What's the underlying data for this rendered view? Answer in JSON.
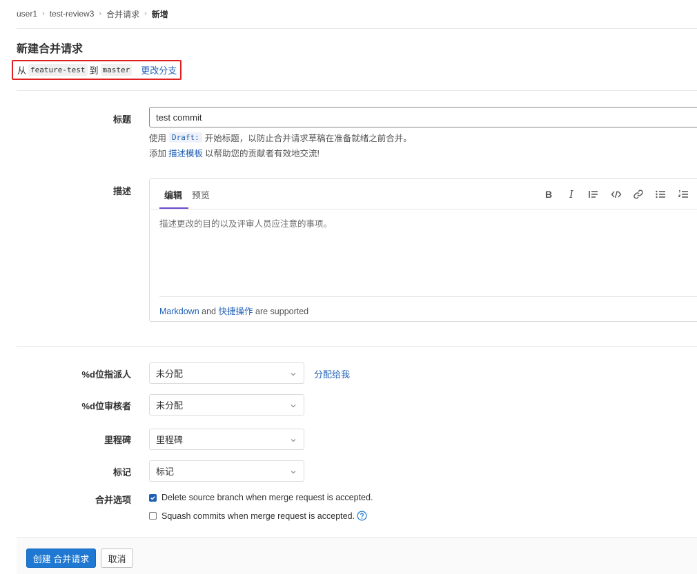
{
  "breadcrumb": {
    "items": [
      "user1",
      "test-review3",
      "合并请求"
    ],
    "current": "新增"
  },
  "page": {
    "title": "新建合并请求"
  },
  "branch_info": {
    "from_label": "从",
    "source": "feature-test",
    "to_label": "到",
    "target": "master",
    "change_link": "更改分支"
  },
  "title_field": {
    "label": "标题",
    "value": "test commit",
    "help1_prefix": "使用",
    "help1_code": "Draft:",
    "help1_suffix": "开始标题，以防止合并请求草稿在准备就绪之前合并。",
    "help2_prefix": "添加",
    "help2_link": "描述模板",
    "help2_suffix": "以帮助您的贡献者有效地交流!"
  },
  "description": {
    "label": "描述",
    "tab_edit": "编辑",
    "tab_preview": "预览",
    "placeholder": "描述更改的目的以及评审人员应注意的事项。",
    "footer_markdown": "Markdown",
    "footer_and": "and",
    "footer_quick": "快捷操作",
    "footer_supported": "are supported"
  },
  "assignee": {
    "label": "%d位指派人",
    "value": "未分配",
    "assign_me": "分配给我"
  },
  "reviewer": {
    "label": "%d位审核者",
    "value": "未分配"
  },
  "milestone": {
    "label": "里程碑",
    "value": "里程碑"
  },
  "labels": {
    "label": "标记",
    "value": "标记"
  },
  "merge_options": {
    "label": "合并选项",
    "delete_branch": "Delete source branch when merge request is accepted.",
    "delete_branch_checked": true,
    "squash": "Squash commits when merge request is accepted.",
    "squash_checked": false
  },
  "actions": {
    "create": "创建 合并请求",
    "cancel": "取消"
  },
  "colors": {
    "link": "#1f5fb4",
    "primary": "#1f78d1",
    "highlight_border": "#e02020",
    "tab_active": "#6e49cb"
  }
}
